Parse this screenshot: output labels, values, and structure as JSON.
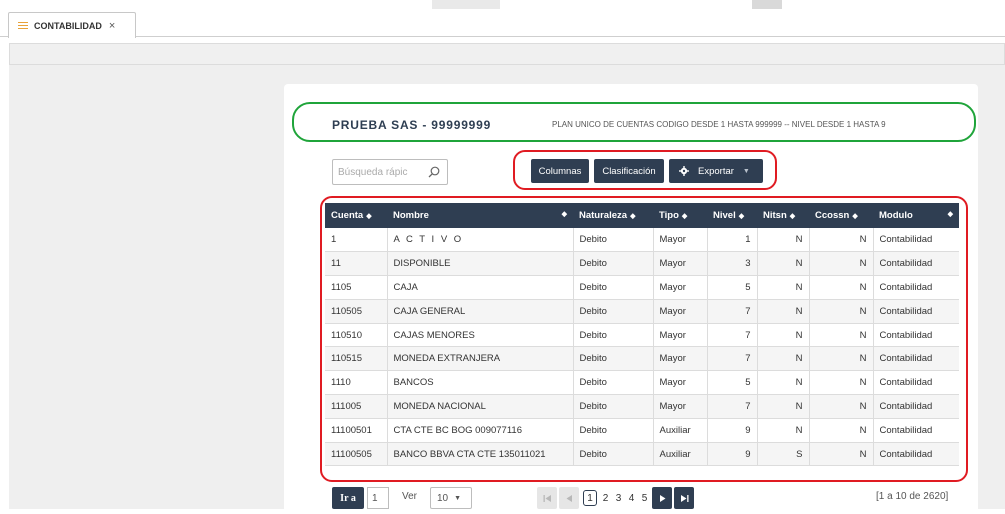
{
  "tab": {
    "label": "CONTABILIDAD",
    "close": "×"
  },
  "header": {
    "company": "PRUEBA SAS - 99999999",
    "plan": "PLAN UNICO DE CUENTAS CODIGO DESDE 1 HASTA 999999 -- NIVEL DESDE 1 HASTA 9"
  },
  "search": {
    "placeholder": "Búsqueda rápic"
  },
  "buttons": {
    "columns": "Columnas",
    "sort": "Clasificación",
    "export": "Exportar"
  },
  "table": {
    "columns": [
      "Cuenta",
      "Nombre",
      "Naturaleza",
      "Tipo",
      "Nivel",
      "Nitsn",
      "Ccossn",
      "Modulo"
    ],
    "rows": [
      [
        "1",
        "A C T I V O",
        "Debito",
        "Mayor",
        "1",
        "N",
        "N",
        "Contabilidad"
      ],
      [
        "11",
        "DISPONIBLE",
        "Debito",
        "Mayor",
        "3",
        "N",
        "N",
        "Contabilidad"
      ],
      [
        "1105",
        "CAJA",
        "Debito",
        "Mayor",
        "5",
        "N",
        "N",
        "Contabilidad"
      ],
      [
        "110505",
        "CAJA GENERAL",
        "Debito",
        "Mayor",
        "7",
        "N",
        "N",
        "Contabilidad"
      ],
      [
        "110510",
        "CAJAS MENORES",
        "Debito",
        "Mayor",
        "7",
        "N",
        "N",
        "Contabilidad"
      ],
      [
        "110515",
        "MONEDA EXTRANJERA",
        "Debito",
        "Mayor",
        "7",
        "N",
        "N",
        "Contabilidad"
      ],
      [
        "1110",
        "BANCOS",
        "Debito",
        "Mayor",
        "5",
        "N",
        "N",
        "Contabilidad"
      ],
      [
        "111005",
        "MONEDA NACIONAL",
        "Debito",
        "Mayor",
        "7",
        "N",
        "N",
        "Contabilidad"
      ],
      [
        "11100501",
        "CTA CTE BC BOG 009077116",
        "Debito",
        "Auxiliar",
        "9",
        "N",
        "N",
        "Contabilidad"
      ],
      [
        "11100505",
        "BANCO BBVA CTA CTE 135011021",
        "Debito",
        "Auxiliar",
        "9",
        "S",
        "N",
        "Contabilidad"
      ]
    ]
  },
  "pagination": {
    "goto_label": "Ir a",
    "goto_value": "1",
    "per_page_label": "Ver",
    "per_page_value": "10",
    "current_page": "1",
    "pages": [
      "2",
      "3",
      "4",
      "5"
    ],
    "range": "[1 a 10 de 2620]"
  },
  "colors": {
    "header_bg": "#2f3e52",
    "highlight_green": "#1fa43a",
    "highlight_red": "#e01b22",
    "tab_icon": "#e8a23a"
  }
}
